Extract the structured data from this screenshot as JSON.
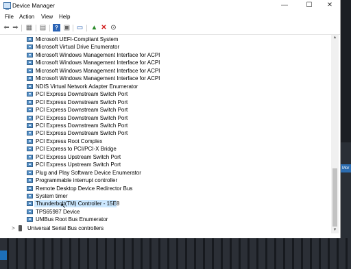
{
  "window": {
    "title": "Device Manager",
    "minimize_symbol": "—",
    "maximize_symbol": "☐",
    "close_symbol": "✕"
  },
  "menu": [
    "File",
    "Action",
    "View",
    "Help"
  ],
  "toolbar": [
    "back-icon",
    "forward-icon",
    "show-hide-tree-icon",
    "properties-icon",
    "help-icon",
    "view-icon",
    "scan-hardware-icon",
    "update-driver-icon",
    "uninstall-icon",
    "disable-icon"
  ],
  "devices": [
    "Microsoft UEFI-Compliant System",
    "Microsoft Virtual Drive Enumerator",
    "Microsoft Windows Management Interface for ACPI",
    "Microsoft Windows Management Interface for ACPI",
    "Microsoft Windows Management Interface for ACPI",
    "Microsoft Windows Management Interface for ACPI",
    "NDIS Virtual Network Adapter Enumerator",
    "PCI Express Downstream Switch Port",
    "PCI Express Downstream Switch Port",
    "PCI Express Downstream Switch Port",
    "PCI Express Downstream Switch Port",
    "PCI Express Downstream Switch Port",
    "PCI Express Downstream Switch Port",
    "PCI Express Root Complex",
    "PCI Express to PCI/PCI-X Bridge",
    "PCI Express Upstream Switch Port",
    "PCI Express Upstream Switch Port",
    "Plug and Play Software Device Enumerator",
    "Programmable interrupt controller",
    "Remote Desktop Device Redirector Bus",
    "System timer",
    "Thunderbolt(TM) Controller - 15E8",
    "TPS65987 Device",
    "UMBus Root Bus Enumerator"
  ],
  "selected_index": 21,
  "category_usb": "Universal Serial Bus controllers",
  "side_label": "Mor"
}
